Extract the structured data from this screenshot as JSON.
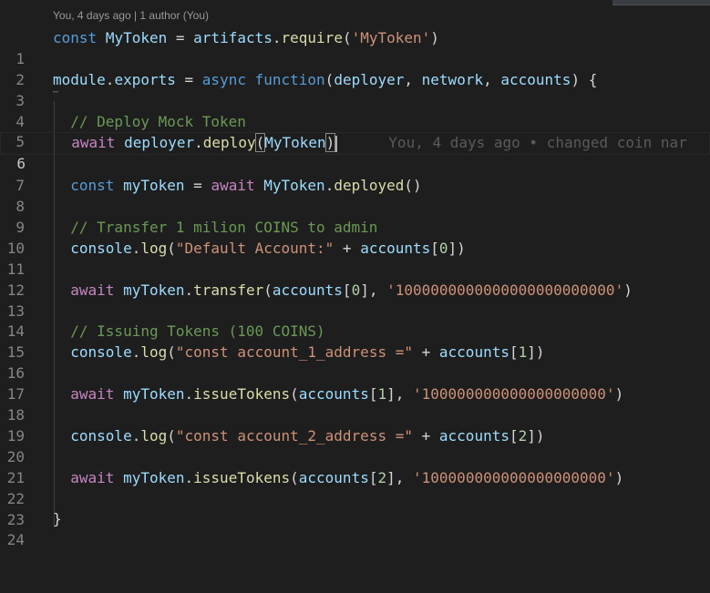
{
  "codelens": "You, 4 days ago | 1 author (You)",
  "active_line": "6",
  "ghost_blame": "You, 4 days ago • changed coin nar",
  "lines": {
    "1": {
      "num": "1",
      "t": [
        "const",
        "MyToken",
        "=",
        "artifacts",
        ".",
        "require",
        "(",
        "'MyToken'",
        ")"
      ]
    },
    "2": {
      "num": "2"
    },
    "3": {
      "num": "3",
      "t": [
        "module",
        ".",
        "exports",
        "=",
        "async",
        "function",
        "(",
        "deployer",
        ",",
        "network",
        ",",
        "accounts",
        ") {"
      ]
    },
    "4": {
      "num": "4"
    },
    "5": {
      "num": "5",
      "t": [
        "// Deploy Mock Token"
      ]
    },
    "6": {
      "num": "6",
      "t": [
        "await",
        "deployer",
        ".",
        "deploy",
        "(",
        "MyToken",
        ")"
      ]
    },
    "7": {
      "num": "7"
    },
    "8": {
      "num": "8",
      "t": [
        "const",
        "myToken",
        "=",
        "await",
        "MyToken",
        ".",
        "deployed",
        "()"
      ]
    },
    "9": {
      "num": "9"
    },
    "10": {
      "num": "10",
      "t": [
        "// Transfer 1 milion COINS to admin"
      ]
    },
    "11": {
      "num": "11",
      "t": [
        "console",
        ".",
        "log",
        "(",
        "\"Default Account:\"",
        "+",
        "accounts",
        "[",
        "0",
        "])"
      ]
    },
    "12": {
      "num": "12"
    },
    "13": {
      "num": "13",
      "t": [
        "await",
        "myToken",
        ".",
        "transfer",
        "(",
        "accounts",
        "[",
        "0",
        "], ",
        "'1000000000000000000000000'",
        ")"
      ]
    },
    "14": {
      "num": "14"
    },
    "15": {
      "num": "15",
      "t": [
        "// Issuing Tokens (100 COINS)"
      ]
    },
    "16": {
      "num": "16",
      "t": [
        "console",
        ".",
        "log",
        "(",
        "\"const account_1_address =\"",
        "+",
        "accounts",
        "[",
        "1",
        "])"
      ]
    },
    "17": {
      "num": "17"
    },
    "18": {
      "num": "18",
      "t": [
        "await",
        "myToken",
        ".",
        "issueTokens",
        "(",
        "accounts",
        "[",
        "1",
        "], ",
        "'100000000000000000000'",
        ")"
      ]
    },
    "19": {
      "num": "19"
    },
    "20": {
      "num": "20",
      "t": [
        "console",
        ".",
        "log",
        "(",
        "\"const account_2_address =\"",
        "+",
        "accounts",
        "[",
        "2",
        "])"
      ]
    },
    "21": {
      "num": "21"
    },
    "22": {
      "num": "22",
      "t": [
        "await",
        "myToken",
        ".",
        "issueTokens",
        "(",
        "accounts",
        "[",
        "2",
        "], ",
        "'100000000000000000000'",
        ")"
      ]
    },
    "23": {
      "num": "23"
    },
    "24": {
      "num": "24",
      "t": [
        "}"
      ]
    }
  }
}
